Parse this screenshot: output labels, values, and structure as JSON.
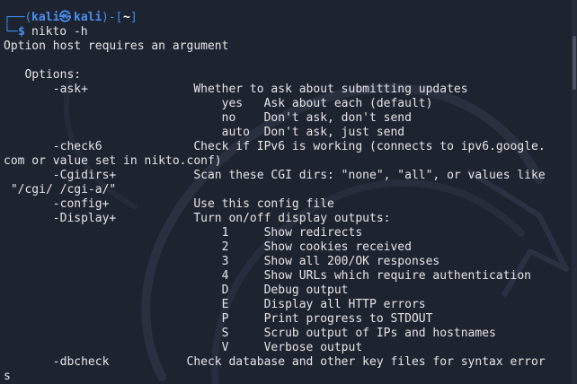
{
  "prompt": {
    "user": "kali",
    "symbol": "㉿",
    "host": "kali",
    "cwd": "~",
    "command": "nikto -h"
  },
  "lines": [
    "Option host requires an argument",
    "",
    "   Options:",
    "       -ask+               Whether to ask about submitting updates",
    "                               yes   Ask about each (default)",
    "                               no    Don't ask, don't send",
    "                               auto  Don't ask, just send",
    "       -check6             Check if IPv6 is working (connects to ipv6.google.",
    "com or value set in nikto.conf)",
    "       -Cgidirs+           Scan these CGI dirs: \"none\", \"all\", or values like",
    " \"/cgi/ /cgi-a/\"",
    "       -config+            Use this config file",
    "       -Display+           Turn on/off display outputs:",
    "                               1     Show redirects",
    "                               2     Show cookies received",
    "                               3     Show all 200/OK responses",
    "                               4     Show URLs which require authentication",
    "                               D     Debug output",
    "                               E     Display all HTTP errors",
    "                               P     Print progress to STDOUT",
    "                               S     Scrub output of IPs and hostnames",
    "                               V     Verbose output",
    "       -dbcheck           Check database and other key files for syntax error",
    "s"
  ]
}
